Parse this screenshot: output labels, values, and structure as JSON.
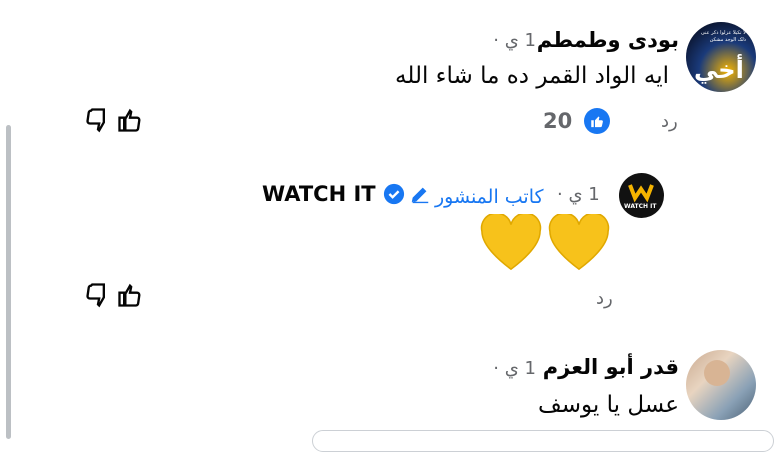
{
  "comments": [
    {
      "author": "بودى  وطمطم",
      "time": "1 ي",
      "sep": "·",
      "text": "ايه الواد القمر ده ما شاء الله",
      "reply": "رد",
      "like_count": "20",
      "avatar_text": "أخي",
      "avatar_small_text": "لا تكيلا عزلوا ذكر عنی ذلک الوجد مشکن"
    },
    {
      "author": "WATCH IT",
      "time": "1 ي",
      "sep": "·",
      "author_badge": "كاتب المنشور",
      "text": "💛💛",
      "reply": "رد",
      "avatar_text": "WATCH IT"
    },
    {
      "author": "قدر أبو العزم",
      "time": "1 ي",
      "sep": "·",
      "text": "عسل يا يوسف"
    }
  ],
  "colors": {
    "like_blue": "#1877f2",
    "heart_yellow": "#f7c21b",
    "meta_gray": "#65676b"
  }
}
